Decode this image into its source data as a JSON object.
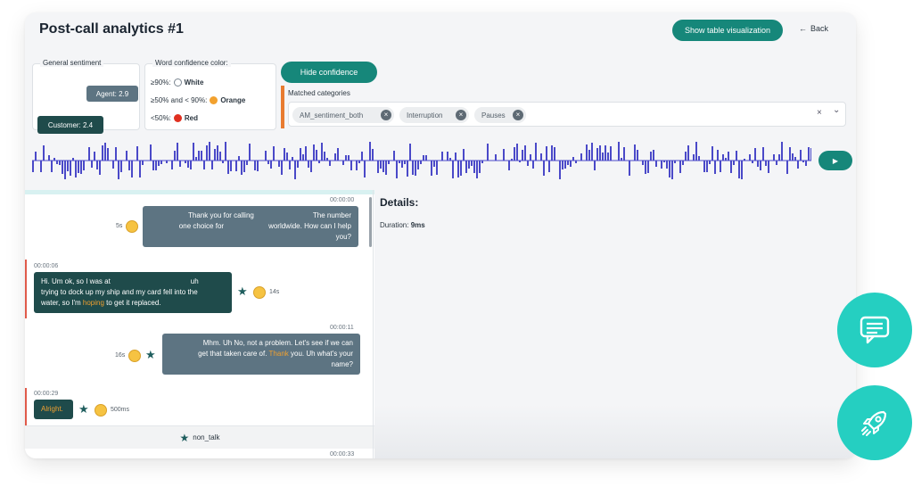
{
  "header": {
    "title": "Post-call analytics #1",
    "show_table_label": "Show table visualization",
    "back_label": "Back",
    "back_arrow": "←"
  },
  "sentiment": {
    "legend": "General sentiment",
    "agent": "Agent: 2.9",
    "customer": "Customer: 2.4"
  },
  "confidence": {
    "legend": "Word confidence color:",
    "rows": [
      {
        "label": "≥90%:",
        "color_name": "White",
        "color": "#ffffff"
      },
      {
        "label": "≥50% and < 90%:",
        "color_name": "Orange",
        "color": "#f2a12e"
      },
      {
        "label": "<50%:",
        "color_name": "Red",
        "color": "#e03020"
      }
    ]
  },
  "hide_confidence_label": "Hide confidence",
  "matched_categories": {
    "label": "Matched categories",
    "chips": [
      "AM_sentiment_both",
      "Interruption",
      "Pauses"
    ],
    "clear_icon": "×",
    "dropdown_icon": "⌄"
  },
  "play_icon": "▶",
  "transcript": {
    "messages": [
      {
        "speaker": "agent",
        "time": "00:00:00",
        "pre": "Thank you for calling",
        "mid": "The number",
        "line2a": "one choice for",
        "line2b": "worldwide. How can I help",
        "line3": "you?",
        "duration": "5s"
      },
      {
        "speaker": "customer",
        "time": "00:00:06",
        "l1a": "Hi. Um ok, so I was at",
        "l1b": "uh",
        "l2": "trying to dock up my ship and my card fell into the",
        "l3a": "water, so I'm ",
        "l3orange": "hoping",
        "l3b": " to get it replaced.",
        "duration": "14s"
      },
      {
        "speaker": "agent",
        "time": "00:00:11",
        "l1": "Mhm. Uh No, not a problem. Let's see if we can",
        "l2a": "get that taken care of. ",
        "l2orange": "Thank",
        "l2b": " you. Uh what's your",
        "l3": "name?",
        "duration": "16s"
      },
      {
        "speaker": "customer",
        "time": "00:00:29",
        "text": "Alright.",
        "duration": "500ms"
      }
    ],
    "non_talk": "non_talk",
    "next_time": "00:00:33"
  },
  "details": {
    "title": "Details:",
    "duration_label": "Duration:",
    "duration_value": "9ms"
  },
  "fabs": {
    "chat": "chat-icon",
    "rocket": "rocket-icon"
  }
}
